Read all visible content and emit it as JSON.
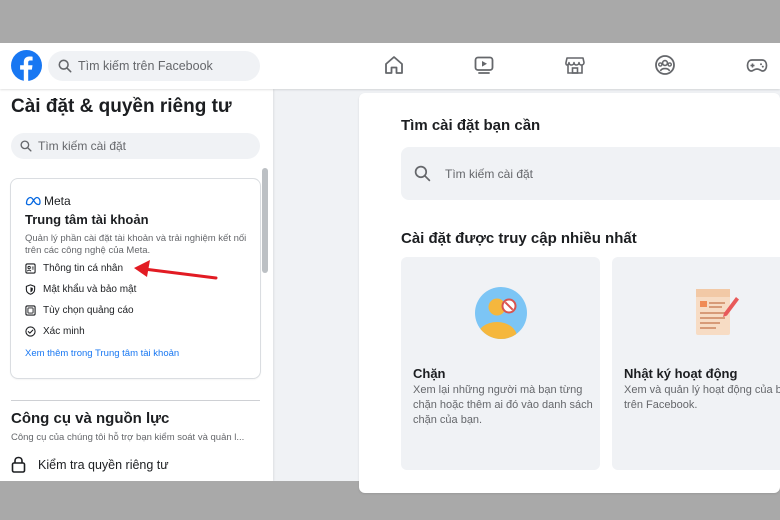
{
  "header": {
    "search_placeholder": "Tìm kiếm trên Facebook",
    "nav_icons": [
      "home-icon",
      "video-icon",
      "marketplace-icon",
      "groups-icon",
      "gaming-icon"
    ]
  },
  "sidebar": {
    "title": "Cài đặt & quyền riêng tư",
    "search_placeholder": "Tìm kiếm cài đặt",
    "meta_card": {
      "brand": "Meta",
      "title": "Trung tâm tài khoản",
      "description": "Quản lý phần cài đặt tài khoản và trải nghiệm kết nối trên các công nghệ của Meta.",
      "items": [
        {
          "label": "Thông tin cá nhân",
          "icon": "id-card-icon"
        },
        {
          "label": "Mật khẩu và bảo mật",
          "icon": "shield-icon"
        },
        {
          "label": "Tùy chọn quảng cáo",
          "icon": "ad-icon"
        },
        {
          "label": "Xác minh",
          "icon": "check-circle-icon"
        }
      ],
      "link": "Xem thêm trong Trung tâm tài khoản"
    },
    "tools": {
      "title": "Công cụ và nguồn lực",
      "description": "Công cụ của chúng tôi hỗ trợ bạn kiểm soát và quản l...",
      "privacy_check": "Kiểm tra quyền riêng tư"
    }
  },
  "main": {
    "find_title": "Tìm cài đặt bạn cần",
    "search_placeholder": "Tìm kiếm cài đặt",
    "frequent_title": "Cài đặt được truy cập nhiều nhất",
    "tiles": [
      {
        "title": "Chặn",
        "description": "Xem lại những người mà bạn từng chặn hoặc thêm ai đó vào danh sách chặn của bạn."
      },
      {
        "title": "Nhật ký hoạt động",
        "description": "Xem và quản lý hoạt động của bạn trên Facebook."
      }
    ]
  },
  "colors": {
    "brand": "#1877f2",
    "annotation_arrow": "#e21b23"
  }
}
